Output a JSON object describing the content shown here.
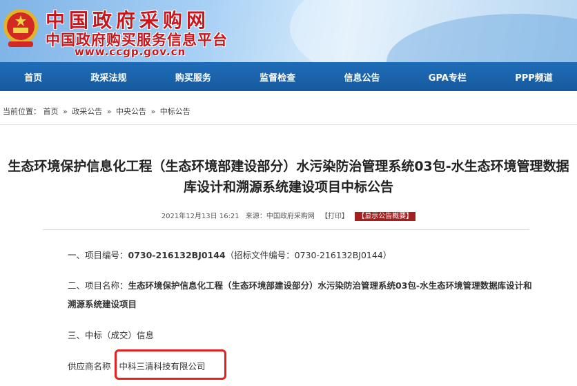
{
  "header": {
    "title": "中国政府采购网",
    "subtitle": "中国政府购买服务信息平台",
    "url": "www.ccgp.gov.cn"
  },
  "nav": {
    "items": [
      "首页",
      "政采法规",
      "购买服务",
      "监督检查",
      "信息公告",
      "GPA专栏",
      "PPP频道"
    ]
  },
  "breadcrumb": {
    "prefix": "当前位置：",
    "items": [
      "首页",
      "政采公告",
      "中央公告",
      "中标公告"
    ],
    "separator": "»"
  },
  "article": {
    "title": "生态环境保护信息化工程（生态环境部建设部分）水污染防治管理系统03包-水生态环境管理数据库设计和溯源系统建设项目中标公告",
    "date": "2021年12月13日 16:21",
    "source": "来源：中国政府采购网",
    "print_label": "【打印】",
    "summary_label": "【显示公告概要】",
    "section1_label": "一、项目编号：",
    "project_number": "0730-216132BJ0144",
    "tender_number": "（招标文件编号：0730-216132BJ0144）",
    "section2_label": "二、项目名称：",
    "project_name": "生态环境保护信息化工程（生态环境部建设部分）水污染防治管理系统03包-水生态环境管理数据库设计和溯源系统建设项目",
    "section3_label": "三、中标（成交）信息",
    "supplier_label": "供应商名称",
    "supplier_name": "中科三清科技有限公司"
  },
  "colors": {
    "brand_red": "#c8161d",
    "nav_blue": "#1a63ad",
    "highlight_red": "#e3211e"
  }
}
